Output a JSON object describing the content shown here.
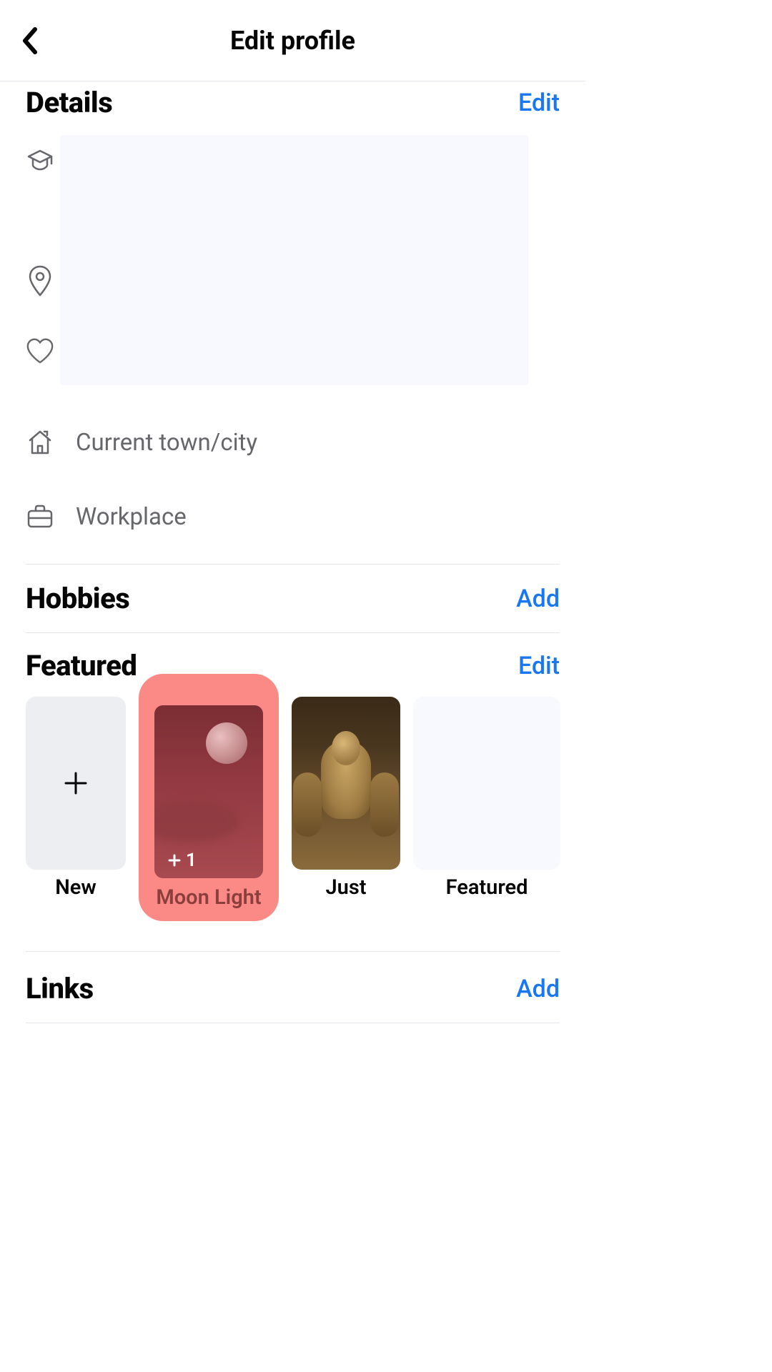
{
  "header": {
    "title": "Edit profile"
  },
  "details": {
    "title": "Details",
    "action": "Edit",
    "current_city_label": "Current town/city",
    "workplace_label": "Workplace"
  },
  "hobbies": {
    "title": "Hobbies",
    "action": "Add"
  },
  "featured": {
    "title": "Featured",
    "action": "Edit",
    "cards": [
      {
        "label": "New"
      },
      {
        "label": "Moon Light",
        "badge": "1",
        "highlighted": true
      },
      {
        "label": "Just"
      },
      {
        "label": "Featured"
      }
    ]
  },
  "links": {
    "title": "Links",
    "action": "Add"
  },
  "colors": {
    "accent": "#1877f2",
    "highlight": "#fb8986"
  }
}
